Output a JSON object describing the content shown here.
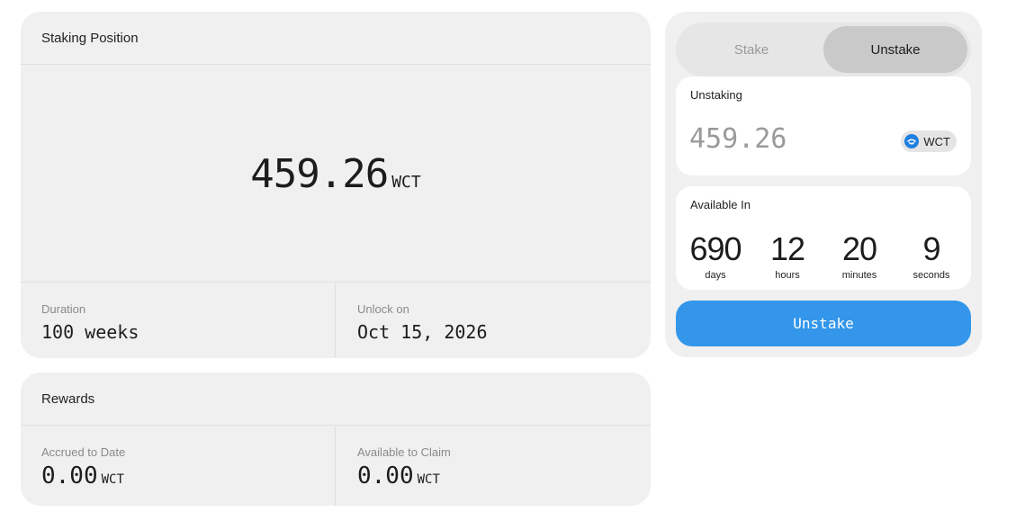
{
  "staking_position": {
    "title": "Staking Position",
    "amount": "459.26",
    "unit": "WCT",
    "duration_label": "Duration",
    "duration_value": "100 weeks",
    "unlock_label": "Unlock on",
    "unlock_value": "Oct 15, 2026"
  },
  "rewards": {
    "title": "Rewards",
    "accrued_label": "Accrued to Date",
    "accrued_value": "0.00",
    "accrued_unit": "WCT",
    "claim_label": "Available to Claim",
    "claim_value": "0.00",
    "claim_unit": "WCT"
  },
  "side_panel": {
    "tabs": [
      {
        "label": "Stake",
        "active": false
      },
      {
        "label": "Unstake",
        "active": true
      }
    ],
    "unstaking": {
      "label": "Unstaking",
      "amount": "459.26",
      "token": "WCT",
      "token_icon": "walletconnect-icon"
    },
    "available_in": {
      "label": "Available In",
      "units": [
        {
          "value": "690",
          "label": "days"
        },
        {
          "value": "12",
          "label": "hours"
        },
        {
          "value": "20",
          "label": "minutes"
        },
        {
          "value": "9",
          "label": "seconds"
        }
      ]
    },
    "action_label": "Unstake"
  },
  "colors": {
    "card_bg": "#f0f0f0",
    "accent": "#3396ea",
    "token_icon": "#1f7fe0",
    "muted_text": "#8a8a8a"
  }
}
